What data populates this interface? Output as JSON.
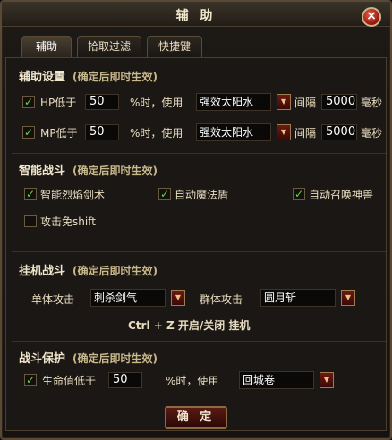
{
  "window": {
    "title": "辅 助",
    "close_icon": "×"
  },
  "tabs": [
    {
      "label": "辅助",
      "active": true
    },
    {
      "label": "拾取过滤",
      "active": false
    },
    {
      "label": "快捷键",
      "active": false
    }
  ],
  "assist": {
    "title": "辅助设置",
    "note": "(确定后即时生效)",
    "hp": {
      "label": "HP低于",
      "value": "50",
      "suffix": "%时，使用",
      "item": "强效太阳水",
      "interval_label": "间隔",
      "interval": "5000",
      "unit": "毫秒",
      "checked": true
    },
    "mp": {
      "label": "MP低于",
      "value": "50",
      "suffix": "%时，使用",
      "item": "强效太阳水",
      "interval_label": "间隔",
      "interval": "5000",
      "unit": "毫秒",
      "checked": true
    }
  },
  "combat": {
    "title": "智能战斗",
    "note": "(确定后即时生效)",
    "options": [
      {
        "label": "智能烈焰剑术",
        "checked": true
      },
      {
        "label": "自动魔法盾",
        "checked": true
      },
      {
        "label": "自动召唤神兽",
        "checked": true
      },
      {
        "label": "攻击免shift",
        "checked": false
      }
    ]
  },
  "auto": {
    "title": "挂机战斗",
    "note": "(确定后即时生效)",
    "single_label": "单体攻击",
    "single_value": "刺杀剑气",
    "group_label": "群体攻击",
    "group_value": "圆月斩",
    "hint": "Ctrl + Z  开启/关闭  挂机"
  },
  "protect": {
    "title": "战斗保护",
    "note": "(确定后即时生效)",
    "label": "生命值低于",
    "value": "50",
    "suffix": "%时，使用",
    "item": "回城卷",
    "checked": true
  },
  "confirm_label": "确 定",
  "check_mark": "✓",
  "dropdown_arrow": "▼"
}
